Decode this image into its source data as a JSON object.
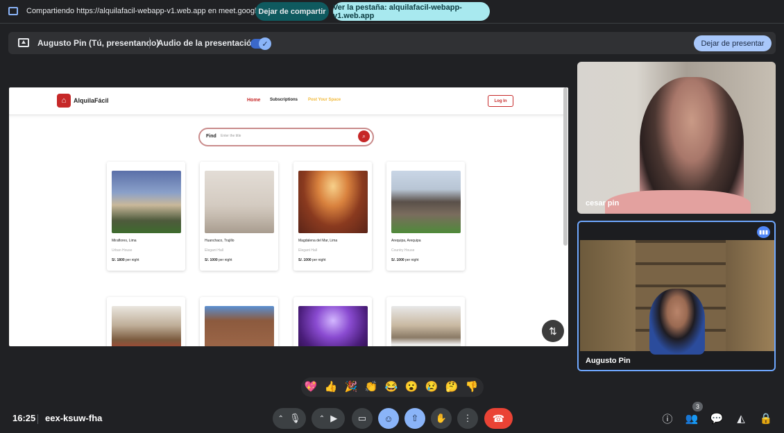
{
  "share_bar": {
    "text": "Compartiendo https://alquilafacil-webapp-v1.web.app en meet.google.com",
    "stop_label": "Dejar de compartir",
    "view_label": "Ver la pestaña: alquilafacil-webapp-v1.web.app"
  },
  "present_bar": {
    "presenter": "Augusto Pin (Tú, presentando)",
    "audio_label": "Audio de la presentación",
    "audio_on": true,
    "stop_label": "Dejar de presentar"
  },
  "webapp": {
    "brand": "AlquilaFácil",
    "nav": {
      "home": "Home",
      "subscriptions": "Subscriptions",
      "post": "Post Your Space",
      "login": "Log In"
    },
    "search": {
      "label": "Find",
      "placeholder": "Enter the title"
    },
    "listings": [
      {
        "location": "Miraflores, Lima",
        "type": "Urban House",
        "price": "S/. 1800",
        "unit": "per night"
      },
      {
        "location": "Huanchaco, Trujillo",
        "type": "Elegant Hall",
        "price": "S/. 1000",
        "unit": "per night"
      },
      {
        "location": "Magdalena del Mar, Lima",
        "type": "Elegant Hall",
        "price": "S/. 1000",
        "unit": "per night"
      },
      {
        "location": "Arequipa, Arequipa",
        "type": "Country House",
        "price": "S/. 1000",
        "unit": "per night"
      }
    ]
  },
  "participants": {
    "cesar": "cesar pin",
    "augusto": "Augusto Pin"
  },
  "reactions": [
    "💖",
    "👍",
    "🎉",
    "👏",
    "😂",
    "😮",
    "😢",
    "🤔",
    "👎"
  ],
  "bottom": {
    "time": "16:25",
    "meeting_code": "eex-ksuw-fha",
    "people_count": "3"
  },
  "colors": {
    "brand": "#c62828",
    "accent": "#8ab4f8",
    "leave": "#ea4335"
  }
}
